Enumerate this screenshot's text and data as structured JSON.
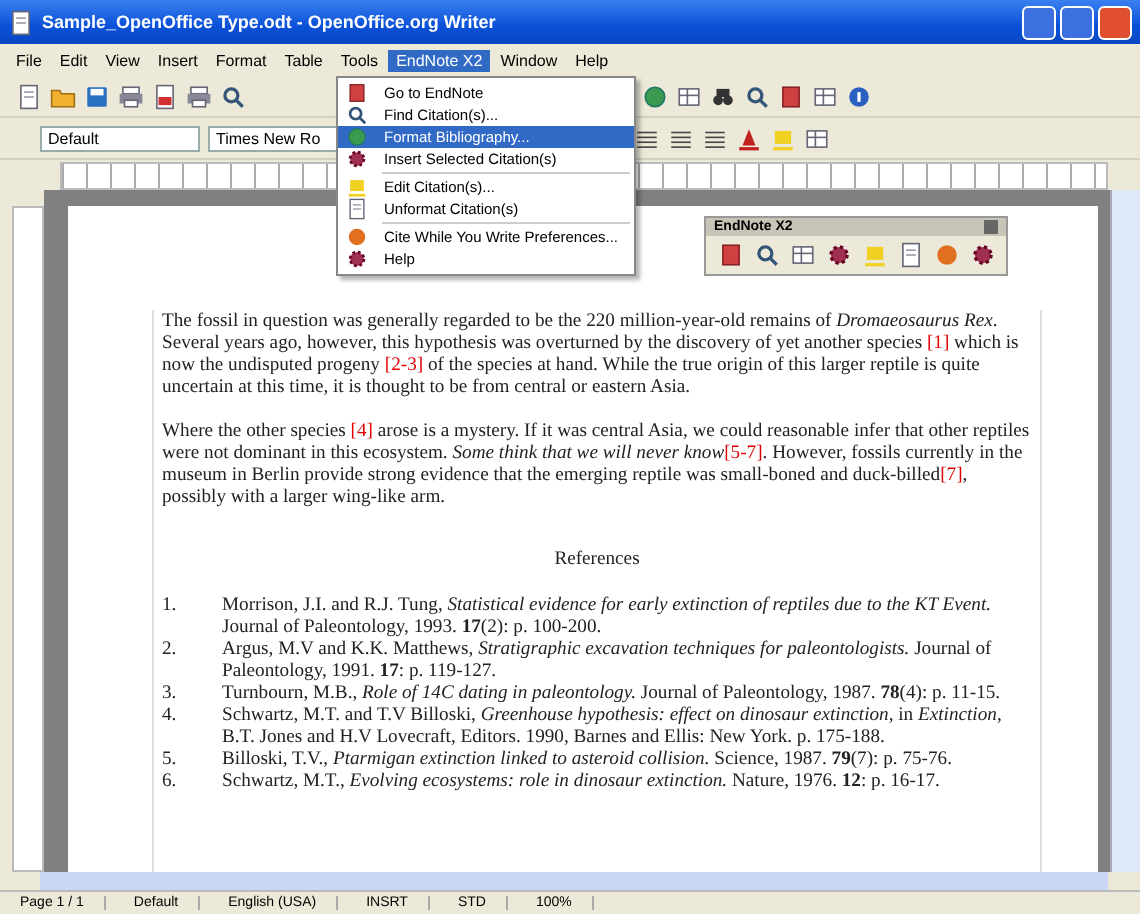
{
  "window": {
    "title": "Sample_OpenOffice Type.odt - OpenOffice.org Writer"
  },
  "menu_bar": [
    {
      "label": "File",
      "selected": false
    },
    {
      "label": "Edit",
      "selected": false
    },
    {
      "label": "View",
      "selected": false
    },
    {
      "label": "Insert",
      "selected": false
    },
    {
      "label": "Format",
      "selected": false
    },
    {
      "label": "Table",
      "selected": false
    },
    {
      "label": "Tools",
      "selected": false
    },
    {
      "label": "EndNote X2",
      "selected": true
    },
    {
      "label": "Window",
      "selected": false
    },
    {
      "label": "Help",
      "selected": false
    }
  ],
  "formatting": {
    "paragraph_style": "Default",
    "font_name": "Times New Ro"
  },
  "endnote_menu": {
    "groups": [
      [
        {
          "label": "Go to EndNote",
          "selected": false
        },
        {
          "label": "Find Citation(s)...",
          "selected": false
        },
        {
          "label": "Format Bibliography...",
          "selected": true
        },
        {
          "label": "Insert Selected Citation(s)",
          "selected": false
        }
      ],
      [
        {
          "label": "Edit Citation(s)...",
          "selected": false
        },
        {
          "label": "Unformat Citation(s)",
          "selected": false
        }
      ],
      [
        {
          "label": "Cite While You Write Preferences...",
          "selected": false
        },
        {
          "label": "Help",
          "selected": false
        }
      ]
    ]
  },
  "endnote_toolbar": {
    "title": "EndNote X2"
  },
  "document": {
    "paragraphs": [
      [
        {
          "kind": "plain",
          "text": "The fossil in question was generally regarded to be the 220 million-year-old remains of "
        },
        {
          "kind": "italic",
          "text": "Dromaeosaurus Rex"
        },
        {
          "kind": "plain",
          "text": ". Several years ago, however, this hypothesis was overturned by the discovery of yet another species "
        },
        {
          "kind": "cite",
          "text": "[1]"
        },
        {
          "kind": "plain",
          "text": " which is now the undisputed progeny "
        },
        {
          "kind": "cite",
          "text": "[2-3]"
        },
        {
          "kind": "plain",
          "text": " of the species at hand. While the true origin of this larger reptile is quite uncertain at this time, it is thought to be from central or eastern Asia."
        }
      ],
      [
        {
          "kind": "plain",
          "text": "Where the other species "
        },
        {
          "kind": "cite",
          "text": "[4]"
        },
        {
          "kind": "plain",
          "text": " arose is a mystery. If it was central Asia, we could reasonable infer that other reptiles were not dominant in this ecosystem. "
        },
        {
          "kind": "italic",
          "text": "Some think that we will never know"
        },
        {
          "kind": "cite",
          "text": "[5-7]"
        },
        {
          "kind": "plain",
          "text": ". However, fossils currently in the museum in Berlin provide strong evidence that the emerging reptile was small-boned and duck-billed"
        },
        {
          "kind": "cite",
          "text": "[7]"
        },
        {
          "kind": "plain",
          "text": ", possibly with a larger wing-like arm."
        }
      ]
    ],
    "references_heading": "References",
    "references": [
      {
        "number": "1.",
        "text": "Morrison, J.I. and R.J. Tung, *Statistical evidence for early extinction of reptiles due to the KT Event.* Journal of Paleontology, 1993. **17**(2): p. 100-200."
      },
      {
        "number": "2.",
        "text": "Argus, M.V and K.K. Matthews, *Stratigraphic excavation techniques for paleontologists.* Journal of Paleontology, 1991. **17**: p. 119-127."
      },
      {
        "number": "3.",
        "text": "Turnbourn, M.B., *Role of 14C dating in paleontology.* Journal of Paleontology, 1987. **78**(4): p. 11-15."
      },
      {
        "number": "4.",
        "text": "Schwartz, M.T. and T.V Billoski, *Greenhouse hypothesis: effect on dinosaur extinction,* in *Extinction*, B.T. Jones and H.V Lovecraft, Editors. 1990, Barnes and Ellis: New York. p. 175-188."
      },
      {
        "number": "5.",
        "text": "Billoski, T.V., *Ptarmigan extinction linked to asteroid collision.* Science, 1987. **79**(7): p. 75-76."
      },
      {
        "number": "6.",
        "text": "Schwartz, M.T., *Evolving ecosystems: role in dinosaur extinction.* Nature, 1976. **12**: p. 16-17."
      }
    ]
  },
  "status_bar": [
    "Page 1 / 1",
    "Default",
    "English (USA)",
    "INSRT",
    "STD",
    "100%"
  ]
}
